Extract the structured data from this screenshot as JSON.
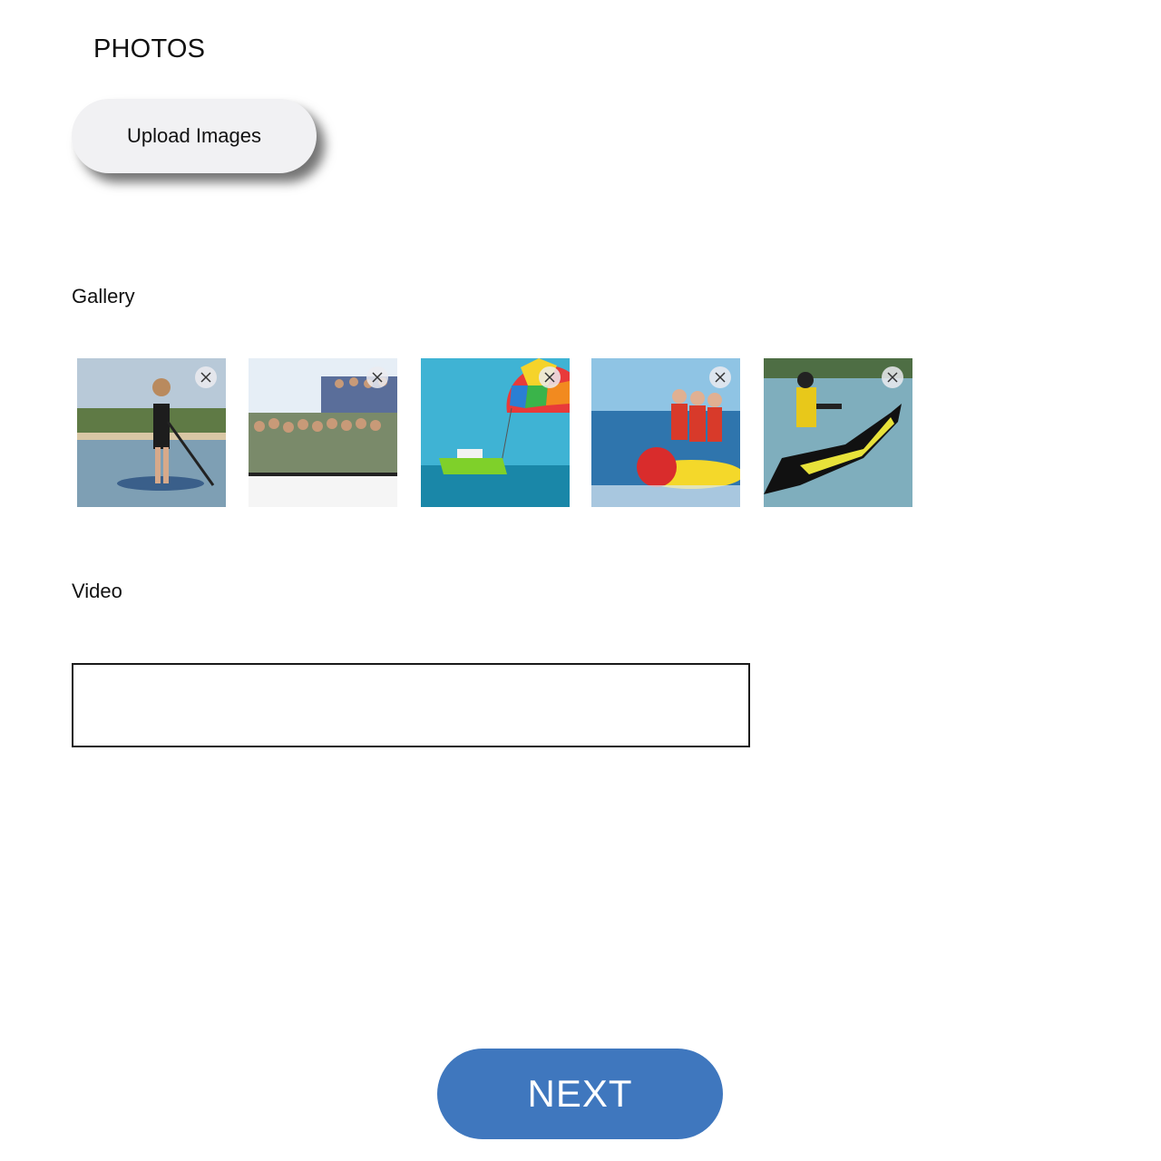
{
  "header": {
    "title": "PHOTOS"
  },
  "upload": {
    "label": "Upload Images"
  },
  "gallery": {
    "label": "Gallery",
    "items": [
      {
        "subject": "paddleboard"
      },
      {
        "subject": "boat-party"
      },
      {
        "subject": "parasailing"
      },
      {
        "subject": "banana-boat"
      },
      {
        "subject": "jet-ski"
      }
    ]
  },
  "video": {
    "label": "Video",
    "value": "",
    "placeholder": ""
  },
  "footer": {
    "next_label": "NEXT"
  },
  "colors": {
    "accent": "#3f77be",
    "upload_bg": "#f1f1f3"
  }
}
